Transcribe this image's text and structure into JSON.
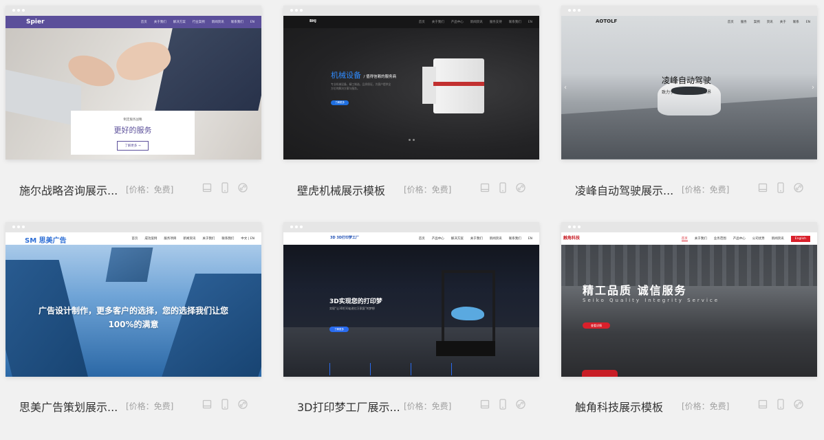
{
  "cards": [
    {
      "title": "施尔战略咨询展示...",
      "price": "[价格：免费]",
      "preview": {
        "logo": "Spier",
        "nav": [
          "首页",
          "关于我们",
          "解决方案",
          "行业案例",
          "新闻资讯",
          "联系我们",
          "EN"
        ],
        "subheading": "制定服务战略",
        "heading": "更好的服务",
        "button": "了解更多 →"
      }
    },
    {
      "title": "壁虎机械展示模板",
      "price": "[价格：免费]",
      "preview": {
        "logo": "BHJ",
        "nav": [
          "首页",
          "关于我们",
          "产品中心",
          "新闻资讯",
          "服务支持",
          "联系我们",
          "EN"
        ],
        "heading": "机械设备",
        "heading_suffix": "/ 值得信赖的服务商",
        "body": "专业机械设备，精工制造，品质保证，为客户提供全方位的解决方案与服务。",
        "button": "了解更多"
      }
    },
    {
      "title": "凌峰自动驾驶展示...",
      "price": "[价格：免费]",
      "preview": {
        "logo": "AOTOLF",
        "nav": [
          "首页",
          "服务",
          "案例",
          "资讯",
          "关于",
          "联系",
          "EN"
        ],
        "heading": "凌峰自动驾驶",
        "subheading": "致力于让自动驾驶改变世界"
      }
    },
    {
      "title": "思美广告策划展示...",
      "price": "[价格：免费]",
      "preview": {
        "logo_mark": "SM",
        "logo_text": "思美广告",
        "nav": [
          "首页",
          "成功案例",
          "服务项目",
          "新闻资讯",
          "关于我们",
          "联系我们",
          "中文 | EN"
        ],
        "heading_line1": "广告设计制作，更多客户的选择，您的选择我们让您",
        "heading_line2": "100%的满意"
      }
    },
    {
      "title": "3D打印梦工厂展示...",
      "price": "[价格：免费]",
      "preview": {
        "logo_mark": "3D",
        "logo_text": "3D打印梦工厂",
        "nav": [
          "首页",
          "产品中心",
          "解决方案",
          "关于我们",
          "新闻资讯",
          "联系我们",
          "EN"
        ],
        "heading": "3D实现您的打印梦",
        "subheading": "实现“让3D打印走进亿万家庭”的梦想",
        "button": "了解更多"
      }
    },
    {
      "title": "触角科技展示模板",
      "price": "[价格：免费]",
      "preview": {
        "logo": "触角科技",
        "nav": [
          "首页",
          "关于我们",
          "业务范围",
          "产品中心",
          "公司优势",
          "新闻资讯"
        ],
        "nav_en": "English",
        "heading": "精工品质 诚信服务",
        "subheading": "Seiko Quality Integrity Service",
        "button": "查看详情"
      }
    }
  ]
}
